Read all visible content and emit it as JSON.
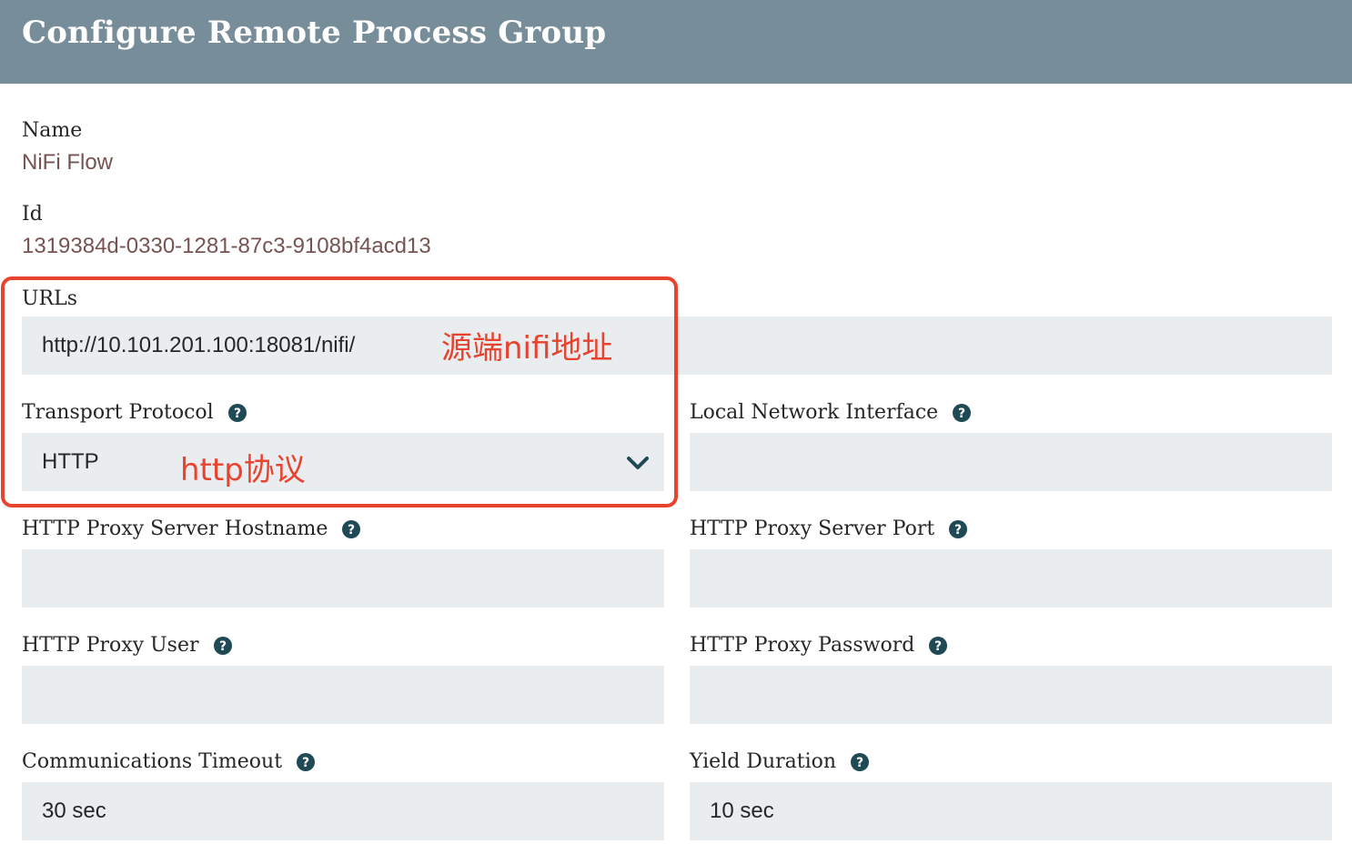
{
  "dialog": {
    "title": "Configure Remote Process Group"
  },
  "name": {
    "label": "Name",
    "value": "NiFi Flow"
  },
  "id": {
    "label": "Id",
    "value": "1319384d-0330-1281-87c3-9108bf4acd13"
  },
  "urls": {
    "label": "URLs",
    "value": "http://10.101.201.100:18081/nifi/"
  },
  "transport_protocol": {
    "label": "Transport Protocol",
    "value": "HTTP"
  },
  "local_network_interface": {
    "label": "Local Network Interface",
    "value": ""
  },
  "http_proxy_server_hostname": {
    "label": "HTTP Proxy Server Hostname",
    "value": ""
  },
  "http_proxy_server_port": {
    "label": "HTTP Proxy Server Port",
    "value": ""
  },
  "http_proxy_user": {
    "label": "HTTP Proxy User",
    "value": ""
  },
  "http_proxy_password": {
    "label": "HTTP Proxy Password",
    "value": ""
  },
  "communications_timeout": {
    "label": "Communications Timeout",
    "value": "30 sec"
  },
  "yield_duration": {
    "label": "Yield Duration",
    "value": "10 sec"
  },
  "annotations": {
    "urls_note": "源端nifi地址",
    "protocol_note": "http协议",
    "color": "#e8432f"
  },
  "colors": {
    "header_bg": "#778d99",
    "field_bg": "#eaedf0",
    "value_text": "#775351",
    "icon": "#1f4a55"
  },
  "icons": {
    "help": "question-circle-icon",
    "dropdown": "chevron-down-icon"
  }
}
